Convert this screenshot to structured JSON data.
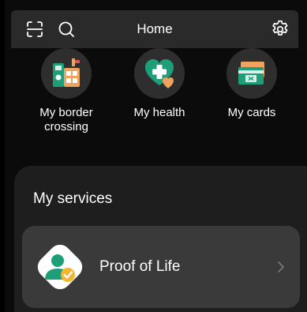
{
  "header": {
    "title": "Home",
    "left_icons": [
      "scan-icon",
      "search-icon"
    ],
    "right_icon": "gear-icon"
  },
  "tiles": [
    {
      "label": "My border\ncrossing",
      "icon": "border-crossing-icon"
    },
    {
      "label": "My health",
      "icon": "health-heart-icon"
    },
    {
      "label": "My cards",
      "icon": "cards-icon"
    }
  ],
  "services": {
    "title": "My services",
    "items": [
      {
        "label": "Proof of Life",
        "icon": "proof-of-life-icon"
      }
    ]
  },
  "colors": {
    "background": "#000000",
    "header_bg": "#2a2a2a",
    "panel_bg": "#1e1e1e",
    "card_bg": "#3a3a3a",
    "accent_green": "#1f9e7a",
    "accent_orange": "#f0a35e",
    "accent_yellow": "#f2b632"
  }
}
